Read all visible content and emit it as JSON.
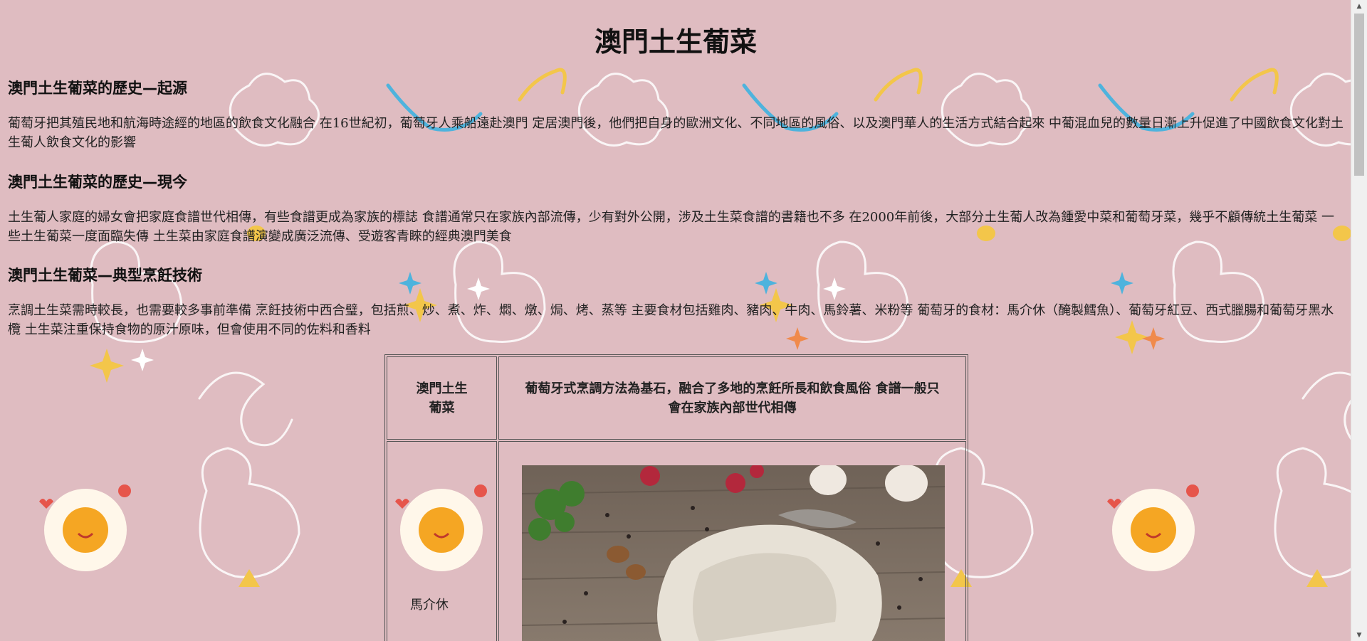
{
  "page": {
    "title": "澳門土生葡菜"
  },
  "sections": [
    {
      "heading": "澳門土生葡菜的歷史—起源",
      "text": "葡萄牙把其殖民地和航海時途經的地區的飲食文化融合 在16世紀初，葡萄牙人乘船遠赴澳門 定居澳門後，他們把自身的歐洲文化、不同地區的風俗、以及澳門華人的生活方式結合起來 中葡混血兒的數量日漸上升促進了中國飲食文化對土生葡人飲食文化的影響"
    },
    {
      "heading": "澳門土生葡菜的歷史—現今",
      "text": "土生葡人家庭的婦女會把家庭食譜世代相傳，有些食譜更成為家族的標誌 食譜通常只在家族內部流傳，少有對外公開，涉及土生菜食譜的書籍也不多 在2000年前後，大部分土生葡人改為鍾愛中菜和葡萄牙菜，幾乎不顧傳統土生葡菜 一些土生葡菜一度面臨失傳 土生菜由家庭食譜演變成廣泛流傳、受遊客青睞的經典澳門美食"
    },
    {
      "heading": "澳門土生葡菜—典型烹飪技術",
      "text": "烹調土生菜需時較長，也需要較多事前準備 烹飪技術中西合璧，包括煎、炒、煮、炸、燜、燉、焗、烤、蒸等 主要食材包括雞肉、豬肉、牛肉、馬鈴薯、米粉等 葡萄牙的食材：馬介休（醃製鱈魚）、葡萄牙紅豆、西式臘腸和葡萄牙黑水欖 土生菜注重保持食物的原汁原味，但會使用不同的佐料和香料"
    }
  ],
  "table": {
    "header_left": "澳門土生\n葡菜",
    "header_right": "葡萄牙式烹調方法為基石，融合了多地的烹飪所長和飲食風俗 食譜一般只會在家族內部世代相傳",
    "row1_left": "馬介休",
    "row1_image": "salted-cod-photo"
  },
  "colors": {
    "background": "#dfbcc1",
    "text": "#222222",
    "table_border": "#555555"
  }
}
